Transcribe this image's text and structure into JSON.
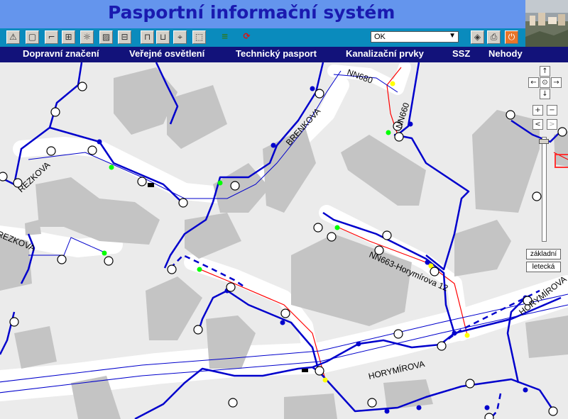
{
  "header": {
    "title": "Pasportní informační systém"
  },
  "toolbar": {
    "buttons": [
      {
        "name": "warning-icon",
        "glyph": "⚠"
      },
      {
        "name": "sign-icon",
        "glyph": "▢"
      },
      {
        "name": "lamp-post-icon",
        "glyph": "⌐"
      },
      {
        "name": "network-icon",
        "glyph": "⊞"
      },
      {
        "name": "bulb-icon",
        "glyph": "☼"
      },
      {
        "name": "hatch-icon",
        "glyph": "▨"
      },
      {
        "name": "car-icon",
        "glyph": "⊟"
      },
      {
        "name": "measure-icon",
        "glyph": "⊓"
      },
      {
        "name": "measure-area-icon",
        "glyph": "⊔"
      },
      {
        "name": "select-tool-icon",
        "glyph": "⌖"
      },
      {
        "name": "pointer-icon",
        "glyph": "⬚"
      },
      {
        "name": "layers-icon",
        "glyph": "≡"
      },
      {
        "name": "refresh-icon",
        "glyph": "⟳"
      },
      {
        "name": "eraser-icon",
        "glyph": "◈"
      },
      {
        "name": "print-icon",
        "glyph": "⎙"
      },
      {
        "name": "power-icon",
        "glyph": "⏻"
      }
    ],
    "select_value": "OK"
  },
  "menu": {
    "items": [
      "Dopravní značení",
      "Veřejné osvětlení",
      "Technický pasport",
      "Kanalizační prvky",
      "SSZ",
      "Nehody"
    ]
  },
  "map": {
    "labels": [
      "NN680",
      "NN660",
      "BRENKOVA",
      "REZKOVA",
      "REZKOVA",
      "NN663-Horymírova 12",
      "HORYMÍROVA",
      "HORYMÍROVA"
    ],
    "nav": {
      "up": "↑",
      "down": "↓",
      "left": "←",
      "right": "→",
      "center": "⊙",
      "zoom_in": "+",
      "zoom_out": "−",
      "back": "<",
      "forward": ">"
    },
    "layers": {
      "basic": "základní",
      "aerial": "letecká"
    },
    "colors": {
      "network": "#0000cc",
      "cable": "#ff0000",
      "building": "#c4c4c4",
      "road": "#ffffff",
      "background": "#ebebeb",
      "green_node": "#00ff00",
      "yellow_node": "#ffff00"
    }
  }
}
